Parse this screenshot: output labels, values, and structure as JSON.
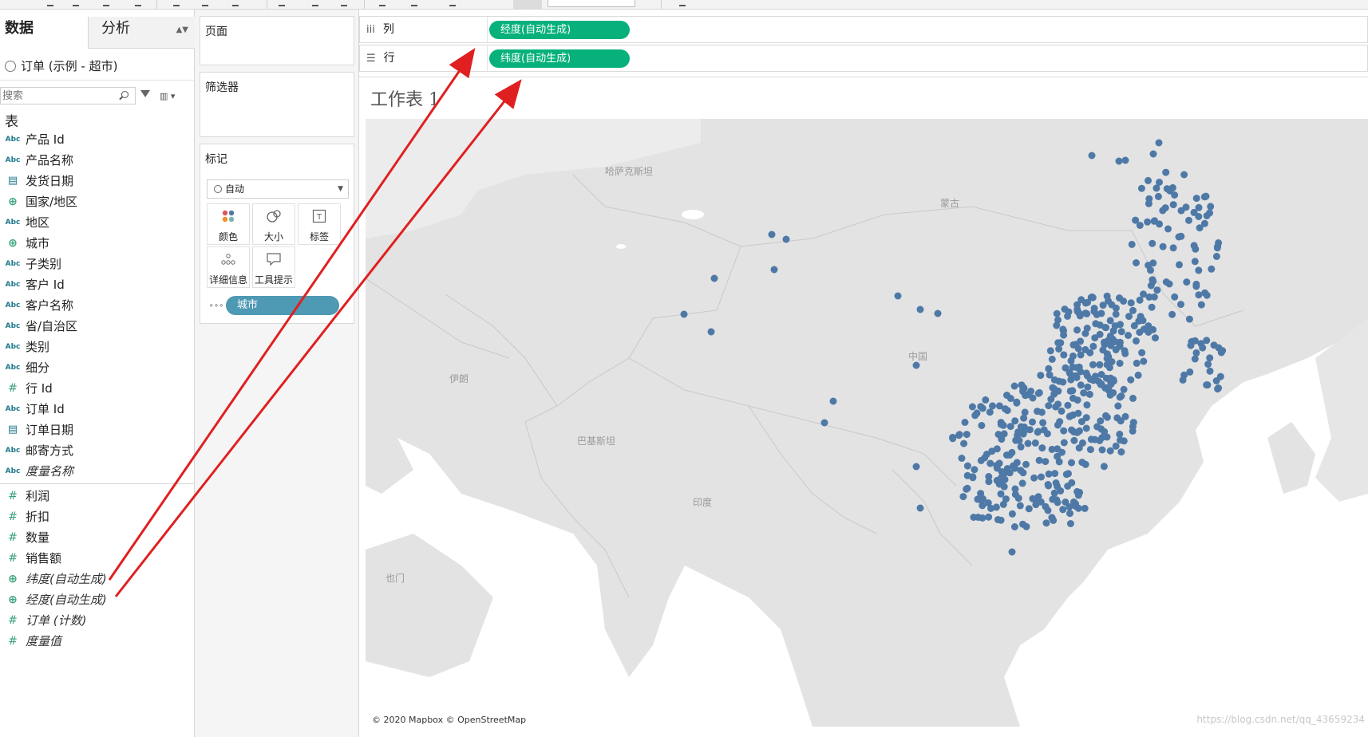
{
  "toolbar": {
    "buttons": [
      "undo-icon",
      "redo-icon",
      "new-worksheet-icon",
      "duplicate-icon",
      "clear-icon",
      "swap-icon",
      "sort-ascending-icon",
      "sort-descending-icon",
      "highlight-icon",
      "group-icon",
      "label-icon",
      "fix-axes-icon",
      "fit-icon",
      "show-me-icon"
    ]
  },
  "left_pane": {
    "tabs": {
      "data": "数据",
      "analysis": "分析"
    },
    "datasource": "订单 (示例 - 超市)",
    "search": {
      "placeholder": "搜索"
    },
    "section_title": "表",
    "fields": [
      {
        "type": "Abc",
        "label": "产品 Id"
      },
      {
        "type": "Abc",
        "label": "产品名称"
      },
      {
        "type": "date",
        "label": "发货日期"
      },
      {
        "type": "geo",
        "label": "国家/地区"
      },
      {
        "type": "Abc",
        "label": "地区"
      },
      {
        "type": "geo",
        "label": "城市"
      },
      {
        "type": "Abc",
        "label": "子类别"
      },
      {
        "type": "Abc",
        "label": "客户 Id"
      },
      {
        "type": "Abc",
        "label": "客户名称"
      },
      {
        "type": "Abc",
        "label": "省/自治区"
      },
      {
        "type": "Abc",
        "label": "类别"
      },
      {
        "type": "Abc",
        "label": "细分"
      },
      {
        "type": "#",
        "label": "行 Id"
      },
      {
        "type": "Abc",
        "label": "订单 Id"
      },
      {
        "type": "date",
        "label": "订单日期"
      },
      {
        "type": "Abc",
        "label": "邮寄方式"
      },
      {
        "type": "Abc",
        "label": "度量名称"
      }
    ],
    "measures": [
      {
        "type": "#",
        "label": "利润"
      },
      {
        "type": "#",
        "label": "折扣"
      },
      {
        "type": "#",
        "label": "数量"
      },
      {
        "type": "#",
        "label": "销售额"
      },
      {
        "type": "geo",
        "label": "纬度(自动生成)"
      },
      {
        "type": "geo",
        "label": "经度(自动生成)"
      },
      {
        "type": "#",
        "label": "订单 (计数)"
      },
      {
        "type": "#",
        "label": "度量值"
      }
    ]
  },
  "mid_pane": {
    "pages_title": "页面",
    "filters_title": "筛选器",
    "marks_title": "标记",
    "mark_type": "自动",
    "mark_buttons": [
      "颜色",
      "大小",
      "标签",
      "详细信息",
      "工具提示"
    ],
    "detail_pill": "城市"
  },
  "view": {
    "columns_label": "列",
    "rows_label": "行",
    "columns_pill": "经度(自动生成)",
    "rows_pill": "纬度(自动生成)",
    "sheet_title": "工作表 1",
    "map_labels": [
      "哈萨克斯坦",
      "蒙古",
      "中国",
      "伊朗",
      "巴基斯坦",
      "印度",
      "也门"
    ],
    "attribution": "© 2020 Mapbox © OpenStreetMap",
    "watermark": "https://blog.csdn.net/qq_43659234",
    "accent_green": "#08b17c",
    "pill_blue": "#4e99b4",
    "dot_color": "#4e79a7",
    "arrow_color": "#e02020"
  }
}
